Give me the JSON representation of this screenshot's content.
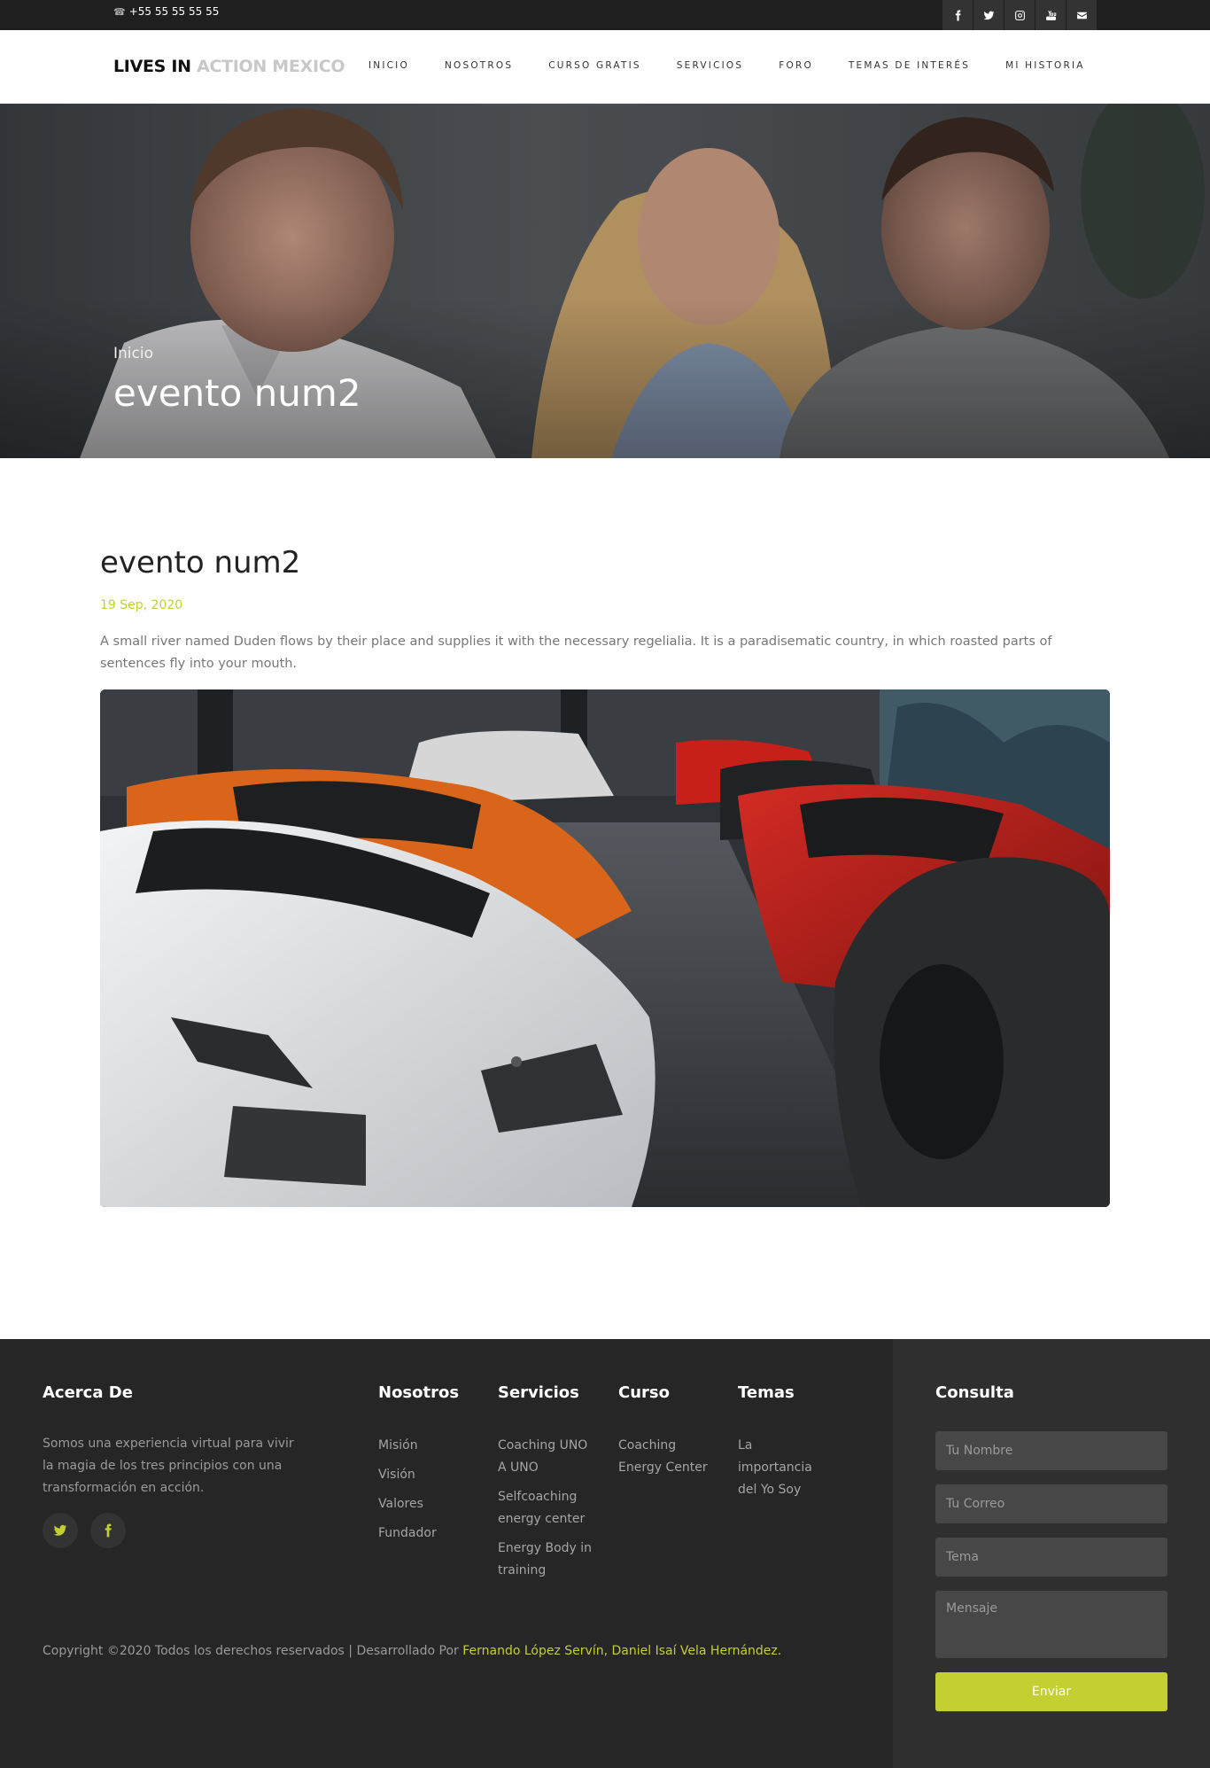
{
  "topbar": {
    "phone": "+55 55 55 55 55",
    "social": [
      "facebook-icon",
      "twitter-icon",
      "instagram-icon",
      "youtube-icon",
      "envelope-icon"
    ]
  },
  "nav": {
    "logo_part1": "LIVES IN",
    "logo_part2": "ACTION MEXICO",
    "items": [
      "INICIO",
      "NOSOTROS",
      "CURSO GRATIS",
      "SERVICIOS",
      "FORO",
      "TEMAS DE INTERÉS",
      "MI HISTORIA"
    ]
  },
  "hero": {
    "breadcrumb": "Inicio",
    "title": "evento num2"
  },
  "post": {
    "title": "evento num2",
    "date": "19 Sep, 2020",
    "text": "A small river named Duden flows by their place and supplies it with the necessary regelialia. It is a paradisematic country, in which roasted parts of sentences fly into your mouth."
  },
  "footer": {
    "about": {
      "heading": "Acerca De",
      "text": "Somos una experiencia virtual para vivir la magia de los tres principios con una transformación en acción."
    },
    "nosotros": {
      "heading": "Nosotros",
      "items": [
        "Misión",
        "Visión",
        "Valores",
        "Fundador"
      ]
    },
    "servicios": {
      "heading": "Servicios",
      "items": [
        "Coaching UNO A UNO",
        "Selfcoaching energy center",
        "Energy Body in training"
      ]
    },
    "curso": {
      "heading": "Curso",
      "items": [
        "Coaching Energy Center"
      ]
    },
    "temas": {
      "heading": "Temas",
      "items": [
        "La importancia del Yo Soy"
      ]
    },
    "consulta": {
      "heading": "Consulta",
      "name_placeholder": "Tu Nombre",
      "email_placeholder": "Tu Correo",
      "subject_placeholder": "Tema",
      "message_placeholder": "Mensaje",
      "send_label": "Enviar"
    },
    "copyright": "Copyright ©2020 Todos los derechos reservados | Desarrollado Por ",
    "authors": "Fernando López Servín, Daniel Isaí Vela Hernández."
  },
  "colors": {
    "accent": "#c4cf31",
    "topbar": "#1f1f1f",
    "footer": "#262626",
    "footer_right": "#2f2f2f"
  }
}
